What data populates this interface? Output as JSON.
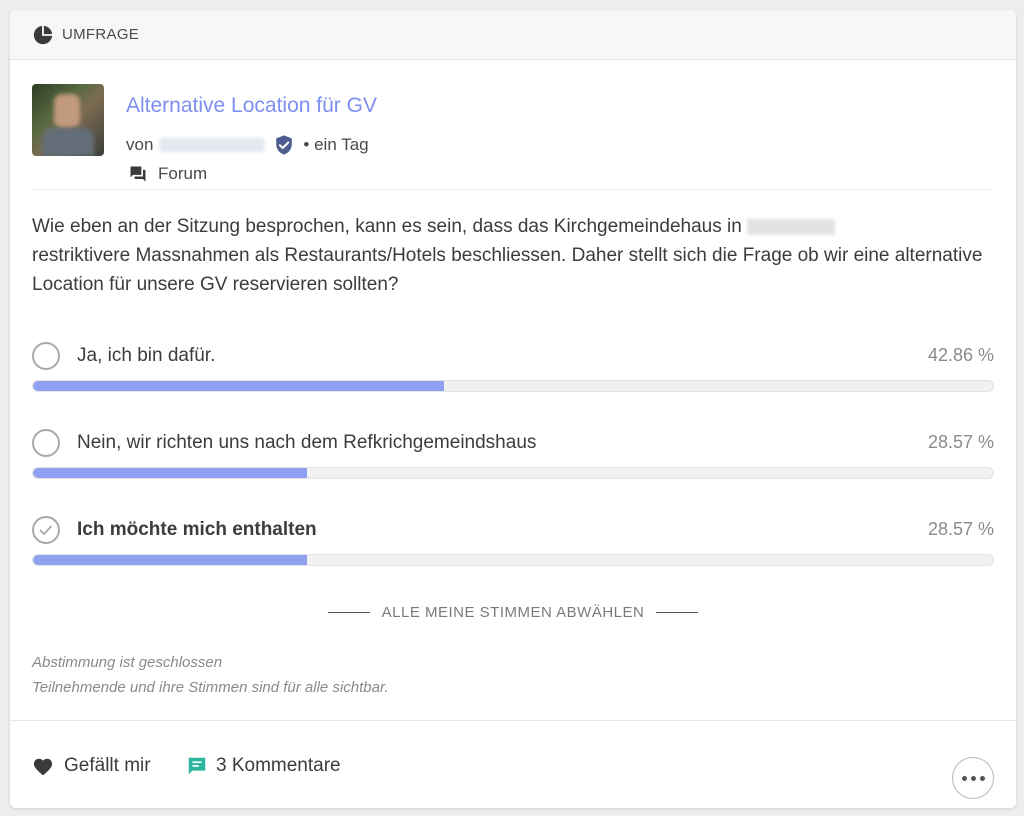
{
  "header": {
    "title": "UMFRAGE",
    "icon": "pie-chart-icon"
  },
  "post": {
    "title": "Alternative Location für GV",
    "by_prefix": "von",
    "time": "• ein Tag",
    "space": "Forum",
    "text_part1": "Wie eben an der Sitzung besprochen, kann es sein, dass das Kirchgemeindehaus in",
    "text_part2": "restriktivere Massnahmen als Restaurants/Hotels beschliessen. Daher stellt sich die Frage ob wir eine alternative Location für unsere GV reservieren sollten?"
  },
  "options": [
    {
      "label": "Ja, ich bin dafür.",
      "percent": "42.86 %",
      "fraction": 0.4286,
      "selected": false
    },
    {
      "label": "Nein, wir richten uns nach dem Refkrichgemeindshaus",
      "percent": "28.57 %",
      "fraction": 0.2857,
      "selected": false
    },
    {
      "label": "Ich möchte mich enthalten",
      "percent": "28.57 %",
      "fraction": 0.2857,
      "selected": true
    }
  ],
  "deselect_label": "ALLE MEINE STIMMEN ABWÄHLEN",
  "info": {
    "closed": "Abstimmung ist geschlossen",
    "visibility": "Teilnehmende und ihre Stimmen sind für alle sichtbar."
  },
  "footer": {
    "like_label": "Gefällt mir",
    "comments_label": "3 Kommentare"
  },
  "colors": {
    "accent": "#7d8ff0",
    "bar": "#8f9ff2",
    "comment_icon": "#2bb59c",
    "verified": "#4d5d8f"
  }
}
